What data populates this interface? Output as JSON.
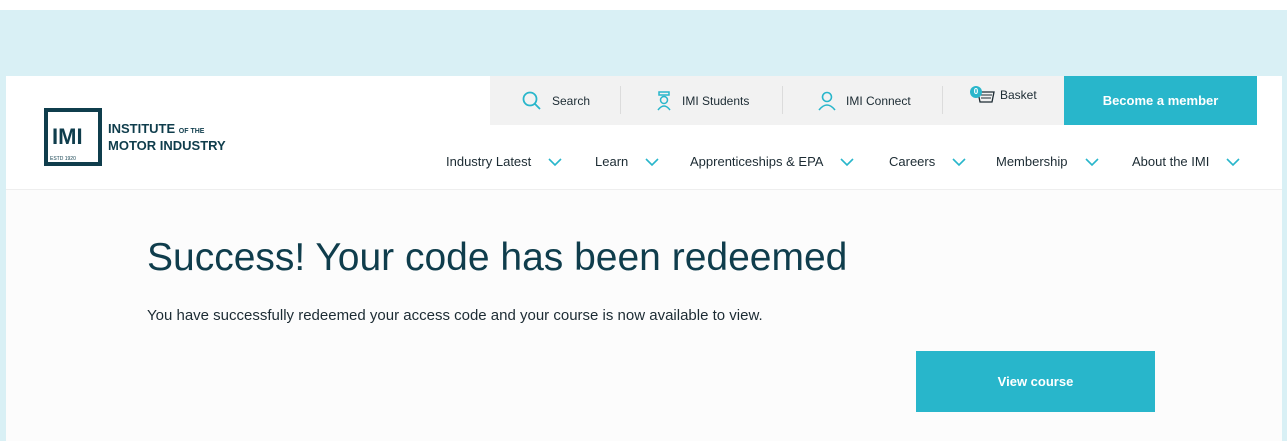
{
  "logo": {
    "mark": "IMI",
    "established": "ESTD 1920",
    "line1": "INSTITUTE",
    "line1_small": "OF THE",
    "line2": "MOTOR INDUSTRY"
  },
  "utility_nav": {
    "search": "Search",
    "students": "IMI Students",
    "connect": "IMI Connect",
    "basket": "Basket",
    "basket_count": "0",
    "member_button": "Become a member"
  },
  "main_nav": [
    {
      "label": "Industry Latest"
    },
    {
      "label": "Learn"
    },
    {
      "label": "Apprenticeships & EPA"
    },
    {
      "label": "Careers"
    },
    {
      "label": "Membership"
    },
    {
      "label": "About the IMI"
    }
  ],
  "content": {
    "title": "Success! Your code has been redeemed",
    "description": "You have successfully redeemed your access code and your course is now available to view.",
    "view_button": "View course"
  },
  "colors": {
    "accent": "#28b6cb",
    "brand_dark": "#0f3d4c",
    "background_band": "#d9f0f5"
  },
  "icons": {
    "search": "search-icon",
    "students": "graduate-icon",
    "connect": "user-icon",
    "basket": "basket-icon",
    "nav_chevron": "chevron-down-icon"
  }
}
